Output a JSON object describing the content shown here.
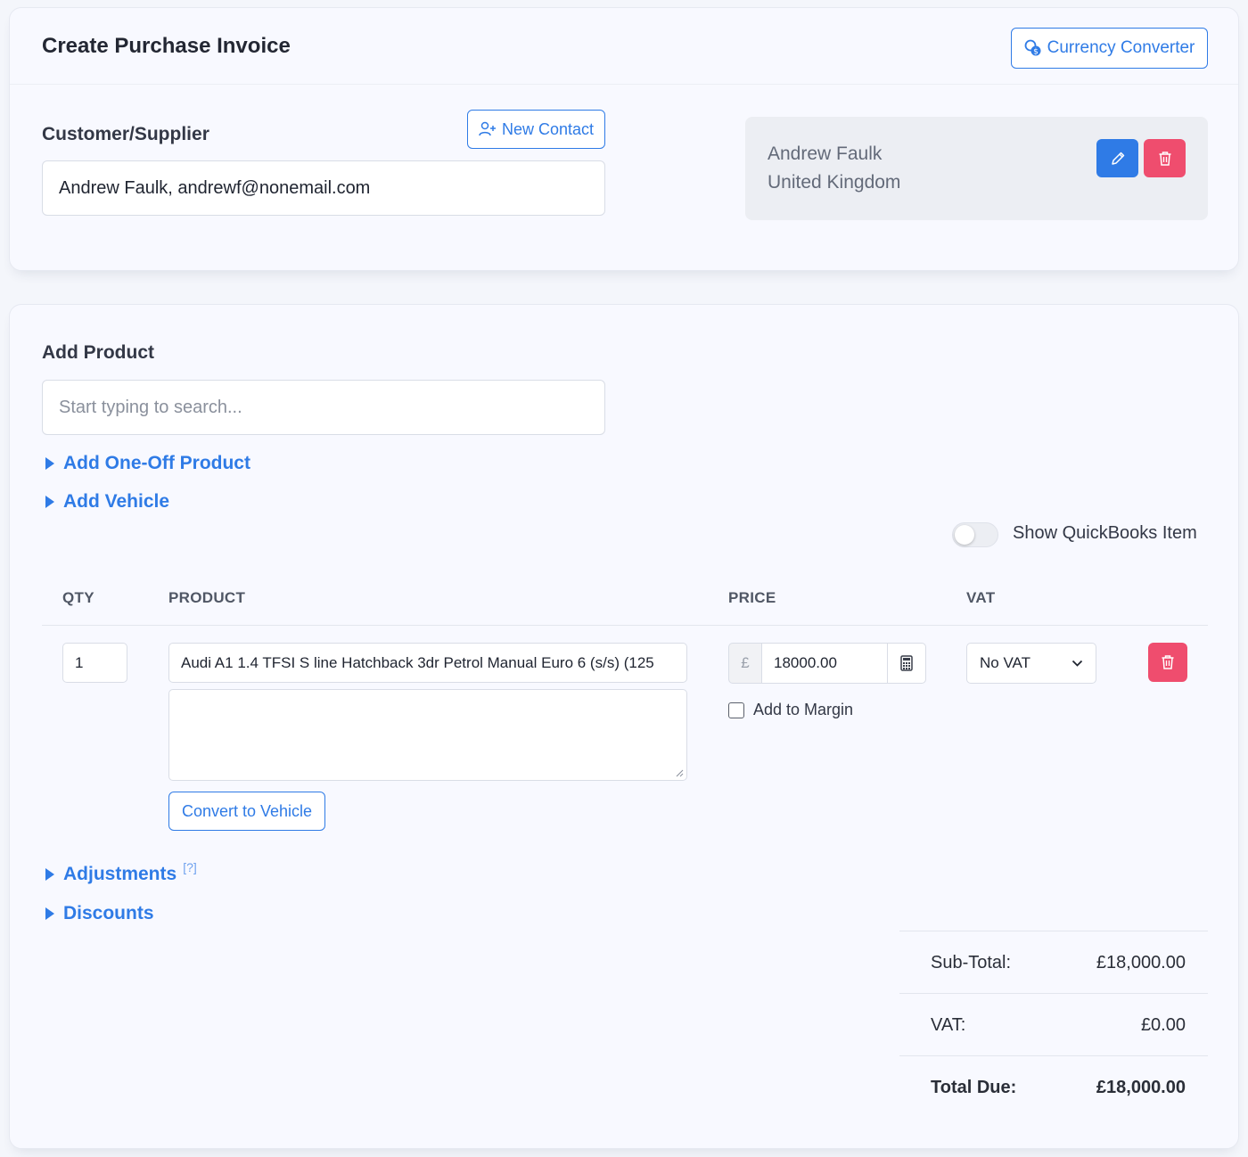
{
  "header": {
    "title": "Create Purchase Invoice",
    "currency_converter_label": "Currency Converter"
  },
  "supplier": {
    "label": "Customer/Supplier",
    "new_contact_label": "New Contact",
    "value": "Andrew Faulk, andrewf@nonemail.com",
    "contact_name": "Andrew Faulk",
    "contact_country": "United Kingdom"
  },
  "product_panel": {
    "add_product_label": "Add Product",
    "search_placeholder": "Start typing to search...",
    "add_one_off_label": "Add One-Off Product",
    "add_vehicle_label": "Add Vehicle",
    "quickbooks_toggle_label": "Show QuickBooks Item",
    "quickbooks_toggle_on": false
  },
  "table": {
    "columns": [
      "QTY",
      "PRODUCT",
      "PRICE",
      "VAT"
    ],
    "rows": [
      {
        "qty": "1",
        "product": "Audi A1 1.4 TFSI S line Hatchback 3dr Petrol Manual Euro 6 (s/s) (125",
        "description": "",
        "convert_label": "Convert to Vehicle",
        "currency_symbol": "£",
        "price": "18000.00",
        "add_to_margin_label": "Add to Margin",
        "add_to_margin_checked": false,
        "vat": "No VAT"
      }
    ]
  },
  "sections": {
    "adjustments_label": "Adjustments",
    "adjustments_help": "[?]",
    "discounts_label": "Discounts"
  },
  "totals": {
    "subtotal_label": "Sub-Total:",
    "subtotal_value": "£18,000.00",
    "vat_label": "VAT:",
    "vat_value": "£0.00",
    "total_label": "Total Due:",
    "total_value": "£18,000.00"
  },
  "colors": {
    "accent": "#2f7be6",
    "danger": "#ef4d6e",
    "background": "#f8f9ff"
  },
  "icons": {
    "currency": "currency-exchange-icon",
    "new_contact": "user-plus-icon",
    "edit": "pencil-icon",
    "delete": "trash-icon",
    "calculator": "calculator-icon",
    "select": "chevron-down-icon",
    "expand": "caret-right-icon"
  }
}
